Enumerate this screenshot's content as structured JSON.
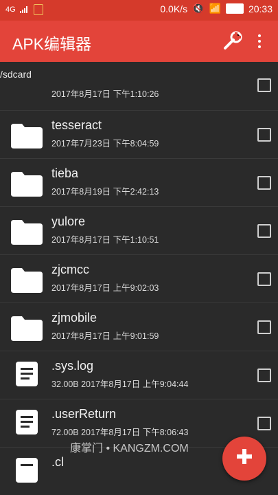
{
  "status_bar": {
    "network": "4G",
    "speed": "0.0K/s",
    "time": "20:33"
  },
  "app_bar": {
    "title": "APK编辑器"
  },
  "path": "/sdcard",
  "files": [
    {
      "name": "",
      "meta": "2017年8月17日 下午1:10:26",
      "type": "folder"
    },
    {
      "name": "tesseract",
      "meta": "2017年7月23日 下午8:04:59",
      "type": "folder"
    },
    {
      "name": "tieba",
      "meta": "2017年8月19日 下午2:42:13",
      "type": "folder"
    },
    {
      "name": "yulore",
      "meta": "2017年8月17日 下午1:10:51",
      "type": "folder"
    },
    {
      "name": "zjcmcc",
      "meta": "2017年8月17日 上午9:02:03",
      "type": "folder"
    },
    {
      "name": "zjmobile",
      "meta": "2017年8月17日 上午9:01:59",
      "type": "folder"
    },
    {
      "name": ".sys.log",
      "meta": "32.00B   2017年8月17日 上午9:04:44",
      "type": "file"
    },
    {
      "name": ".userReturn",
      "meta": "72.00B   2017年8月17日 下午8:06:43",
      "type": "file"
    },
    {
      "name": ".cl",
      "meta": "",
      "type": "file"
    }
  ],
  "watermark": "康掌门 • KANGZM.COM",
  "colors": {
    "status_bar": "#d53a2b",
    "app_bar": "#e3443a",
    "background": "#2a2a2a",
    "fab": "#e3443a"
  }
}
